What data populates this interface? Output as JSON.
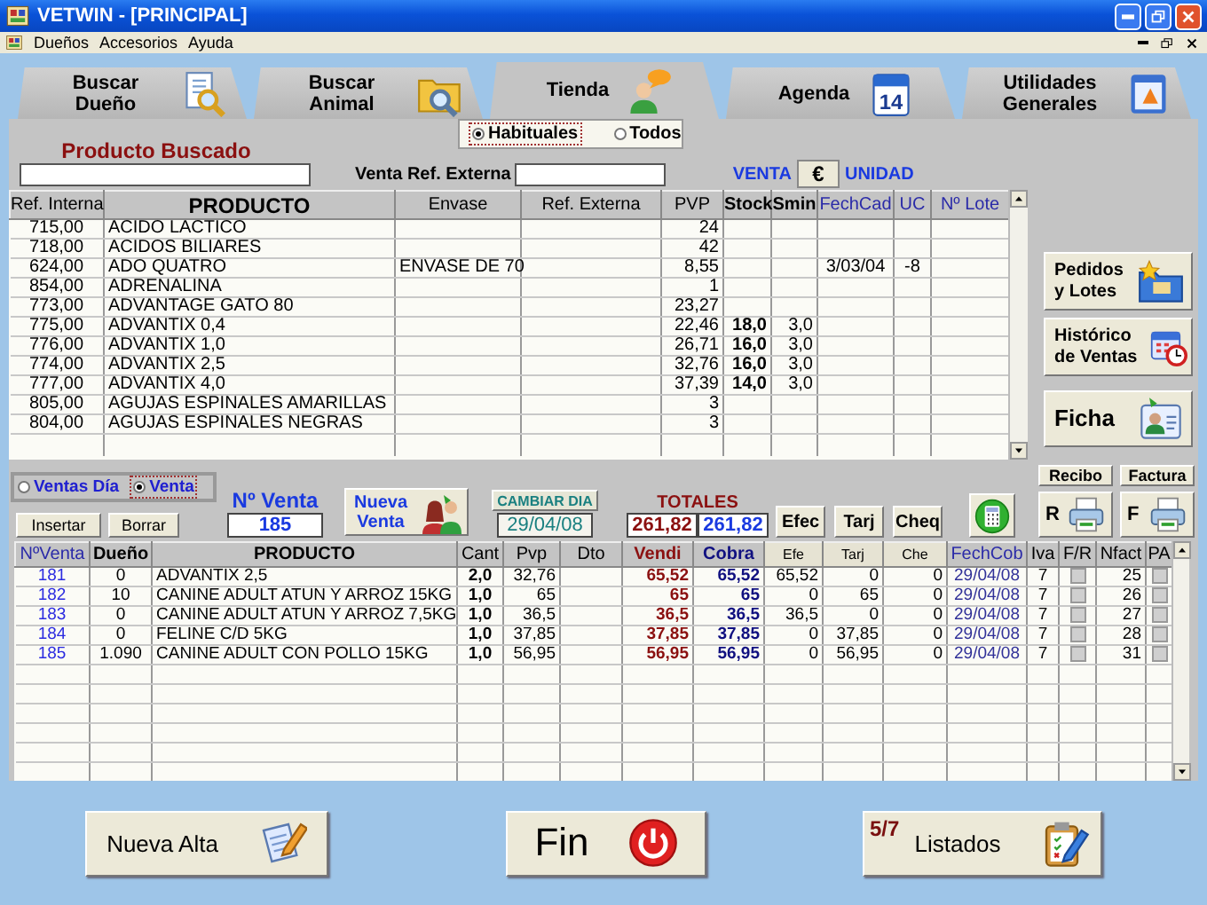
{
  "window": {
    "title": "VETWIN - [PRINCIPAL]"
  },
  "menu": [
    "Dueños",
    "Accesorios",
    "Ayuda"
  ],
  "tabs": [
    {
      "label": "Buscar Dueño",
      "selected": false
    },
    {
      "label": "Buscar Animal",
      "selected": false
    },
    {
      "label": "Tienda",
      "selected": true
    },
    {
      "label": "Agenda",
      "selected": false,
      "icon_text": "14"
    },
    {
      "label": "Utilidades Generales",
      "selected": false
    }
  ],
  "search_mode": [
    {
      "label": "Habituales",
      "selected": true
    },
    {
      "label": "Todos",
      "selected": false
    }
  ],
  "product_search": {
    "label": "Producto Buscado"
  },
  "external_ref": {
    "label": "Venta Ref. Externa"
  },
  "price_mode": {
    "label": "VENTA",
    "currency": "€",
    "unit": "UNIDAD"
  },
  "products": {
    "columns": [
      {
        "label": "Ref. Interna",
        "kind": "text"
      },
      {
        "label": "PRODUCTO",
        "kind": "text"
      },
      {
        "label": "Envase",
        "kind": "text"
      },
      {
        "label": "Ref. Externa",
        "kind": "text"
      },
      {
        "label": "PVP",
        "kind": "text"
      },
      {
        "label": "Stock",
        "kind": "text"
      },
      {
        "label": "Smin",
        "kind": "text"
      },
      {
        "label": "FechCad",
        "kind": "text"
      },
      {
        "label": "UC",
        "kind": "text"
      },
      {
        "label": "Nº Lote",
        "kind": "text"
      }
    ],
    "rows": [
      {
        "ref": "715,00",
        "product": "ACIDO LACTICO",
        "pvp": "24"
      },
      {
        "ref": "718,00",
        "product": "ACIDOS BILIARES",
        "pvp": "42"
      },
      {
        "ref": "624,00",
        "product": "ADO QUATRO",
        "package": "ENVASE DE 70",
        "pvp": "8,55",
        "expiry": "3/03/04",
        "uc": "-8"
      },
      {
        "ref": "854,00",
        "product": "ADRENALINA",
        "pvp": "1"
      },
      {
        "ref": "773,00",
        "product": "ADVANTAGE GATO 80",
        "pvp": "23,27"
      },
      {
        "ref": "775,00",
        "product": "ADVANTIX 0,4",
        "pvp": "22,46",
        "stock": "18,0",
        "min": "3,0"
      },
      {
        "ref": "776,00",
        "product": "ADVANTIX 1,0",
        "pvp": "26,71",
        "stock": "16,0",
        "min": "3,0"
      },
      {
        "ref": "774,00",
        "product": "ADVANTIX 2,5",
        "pvp": "32,76",
        "stock": "16,0",
        "min": "3,0"
      },
      {
        "ref": "777,00",
        "product": "ADVANTIX 4,0",
        "pvp": "37,39",
        "stock": "14,0",
        "min": "3,0"
      },
      {
        "ref": "805,00",
        "product": "AGUJAS ESPINALES AMARILLAS",
        "pvp": "3"
      },
      {
        "ref": "804,00",
        "product": "AGUJAS ESPINALES NEGRAS",
        "pvp": "3"
      }
    ]
  },
  "side_buttons": [
    {
      "label": "Pedidos y Lotes"
    },
    {
      "label": "Histórico de Ventas"
    },
    {
      "label": "Ficha"
    }
  ],
  "print": [
    {
      "label": "Recibo",
      "letter": "R"
    },
    {
      "label": "Factura",
      "letter": "F"
    }
  ],
  "sales_view": [
    {
      "label": "Ventas Día",
      "selected": false
    },
    {
      "label": "Venta",
      "selected": true
    }
  ],
  "actions": [
    "Insertar",
    "Borrar"
  ],
  "sale_number": {
    "label": "Nº Venta",
    "value": "185"
  },
  "new_sale": {
    "label": "Nueva Venta"
  },
  "day": {
    "button": "CAMBIAR DIA",
    "value": "29/04/08"
  },
  "totals": {
    "label": "TOTALES",
    "sold": "261,82",
    "charged": "261,82"
  },
  "payment": [
    "Efec",
    "Tarj",
    "Cheq"
  ],
  "sales": {
    "columns": [
      {
        "label": "NºVenta",
        "kind": "text"
      },
      {
        "label": "Dueño",
        "kind": "text"
      },
      {
        "label": "PRODUCTO",
        "kind": "text"
      },
      {
        "label": "Cant",
        "kind": "text"
      },
      {
        "label": "Pvp",
        "kind": "text"
      },
      {
        "label": "Dto",
        "kind": "text"
      },
      {
        "label": "Vendi",
        "kind": "text"
      },
      {
        "label": "Cobra",
        "kind": "text"
      },
      {
        "label": "Efe",
        "kind": "text"
      },
      {
        "label": "Tarj",
        "kind": "text"
      },
      {
        "label": "Che",
        "kind": "text"
      },
      {
        "label": "FechCob",
        "kind": "text"
      },
      {
        "label": "Iva",
        "kind": "text"
      },
      {
        "label": "F/R",
        "kind": "checkbox"
      },
      {
        "label": "Nfact",
        "kind": "text"
      },
      {
        "label": "PA",
        "kind": "checkbox"
      }
    ],
    "rows": [
      {
        "number": "181",
        "owner": "0",
        "product": "ADVANTIX 2,5",
        "qty": "2,0",
        "pvp": "32,76",
        "sold": "65,52",
        "charged": "65,52",
        "cash": "65,52",
        "card": "0",
        "cheque": "0",
        "date": "29/04/08",
        "iva": "7",
        "fr": false,
        "invoice": "25",
        "pa": false
      },
      {
        "number": "182",
        "owner": "10",
        "product": "CANINE ADULT ATUN Y ARROZ 15KG",
        "qty": "1,0",
        "pvp": "65",
        "sold": "65",
        "charged": "65",
        "cash": "0",
        "card": "65",
        "cheque": "0",
        "date": "29/04/08",
        "iva": "7",
        "fr": false,
        "invoice": "26",
        "pa": false
      },
      {
        "number": "183",
        "owner": "0",
        "product": "CANINE ADULT ATUN Y ARROZ 7,5KG",
        "qty": "1,0",
        "pvp": "36,5",
        "sold": "36,5",
        "charged": "36,5",
        "cash": "36,5",
        "card": "0",
        "cheque": "0",
        "date": "29/04/08",
        "iva": "7",
        "fr": false,
        "invoice": "27",
        "pa": false
      },
      {
        "number": "184",
        "owner": "0",
        "product": "FELINE C/D 5KG",
        "qty": "1,0",
        "pvp": "37,85",
        "sold": "37,85",
        "charged": "37,85",
        "cash": "0",
        "card": "37,85",
        "cheque": "0",
        "date": "29/04/08",
        "iva": "7",
        "fr": false,
        "invoice": "28",
        "pa": false
      },
      {
        "number": "185",
        "owner": "1.090",
        "product": "CANINE ADULT CON POLLO 15KG",
        "qty": "1,0",
        "pvp": "56,95",
        "sold": "56,95",
        "charged": "56,95",
        "cash": "0",
        "card": "56,95",
        "cheque": "0",
        "date": "29/04/08",
        "iva": "7",
        "fr": false,
        "invoice": "31",
        "pa": false
      }
    ]
  },
  "bottom_buttons": [
    {
      "label": "Nueva Alta"
    },
    {
      "label": "Fin"
    },
    {
      "label": "Listados",
      "badge": "5/7"
    }
  ]
}
